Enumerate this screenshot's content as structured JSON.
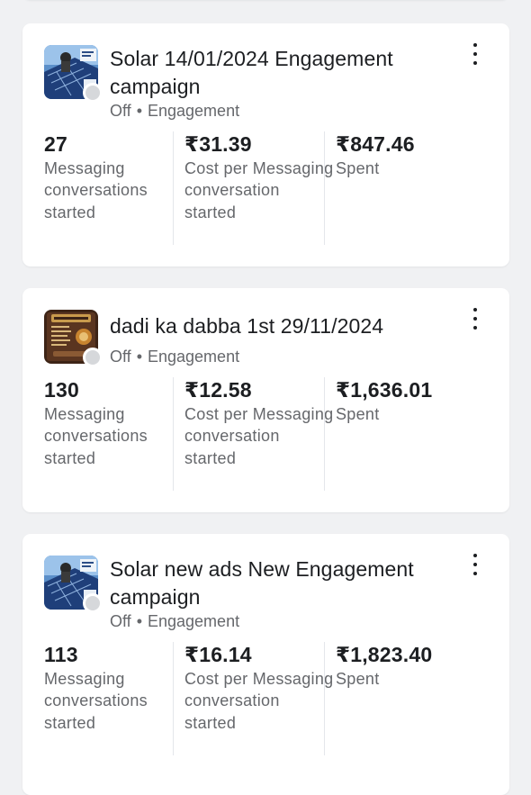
{
  "campaigns": [
    {
      "title": "Solar 14/01/2024 Engagement campaign",
      "status": "Off",
      "objective": "Engagement",
      "thumbnail": "solar-panel-thumbnail",
      "metrics": {
        "results_value": "27",
        "results_label": "Messaging conversations started",
        "cost_value": "₹31.39",
        "cost_label": "Cost per Messaging conversation started",
        "spent_value": "₹847.46",
        "spent_label": "Spent"
      }
    },
    {
      "title": "dadi ka dabba 1st  29/11/2024",
      "status": "Off",
      "objective": "Engagement",
      "thumbnail": "food-menu-thumbnail",
      "metrics": {
        "results_value": "130",
        "results_label": "Messaging conversations started",
        "cost_value": "₹12.58",
        "cost_label": "Cost per Messaging conversation started",
        "spent_value": "₹1,636.01",
        "spent_label": "Spent"
      }
    },
    {
      "title": "Solar new ads New Engagement campaign",
      "status": "Off",
      "objective": "Engagement",
      "thumbnail": "solar-panel-thumbnail",
      "metrics": {
        "results_value": "113",
        "results_label": "Messaging conversations started",
        "cost_value": "₹16.14",
        "cost_label": "Cost per Messaging conversation started",
        "spent_value": "₹1,823.40",
        "spent_label": "Spent"
      }
    }
  ],
  "separator": "•",
  "colors": {
    "background": "#f0f1f3",
    "card": "#ffffff",
    "primary_text": "#1c1e21",
    "secondary_text": "#65676b",
    "status_off_dot": "#d6d8db"
  }
}
